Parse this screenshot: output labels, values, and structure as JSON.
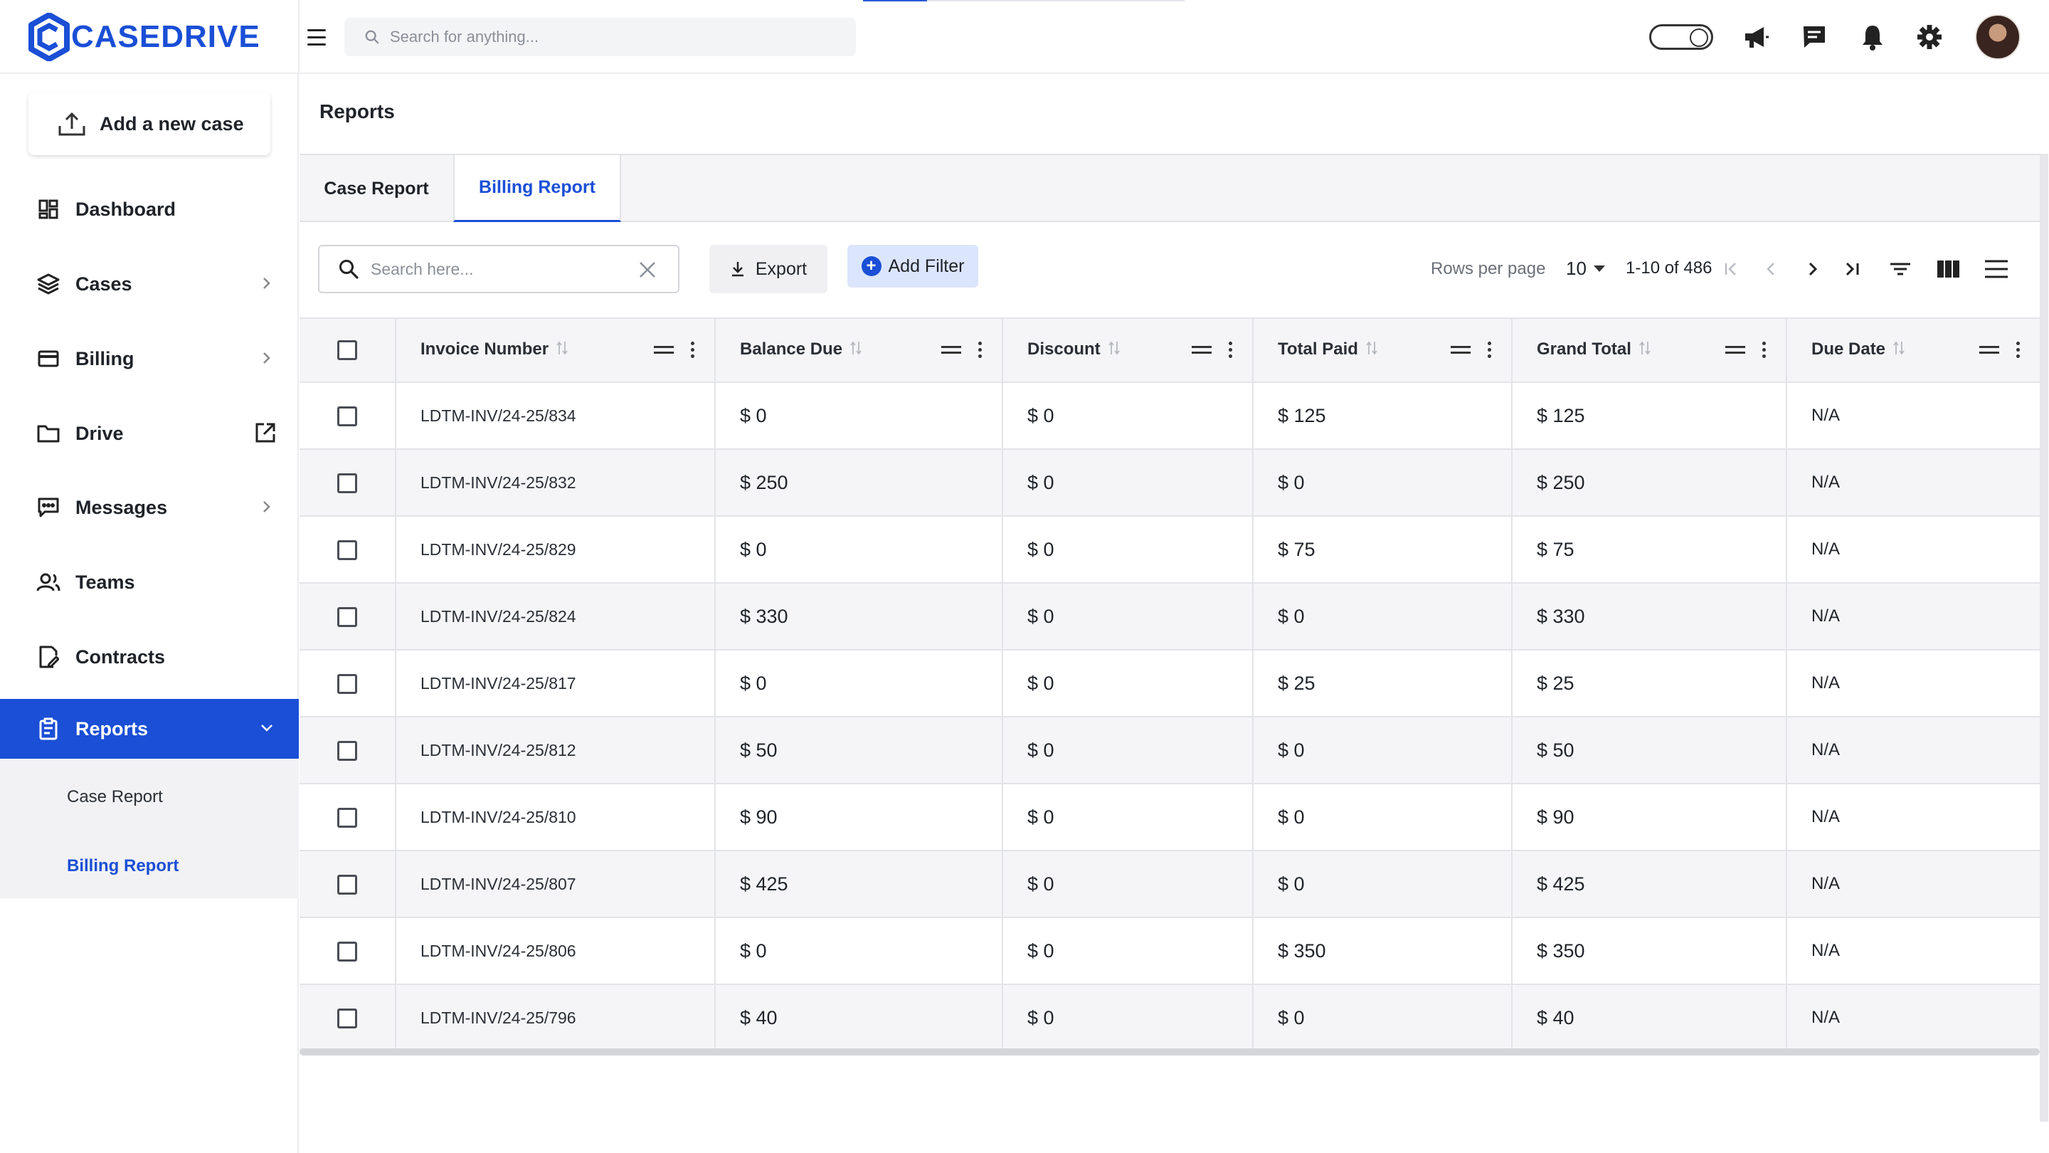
{
  "app": {
    "brand": "CASEDRIVE",
    "brand_color": "#1a4fd6",
    "loading_progress": 0.2
  },
  "topbar": {
    "search_placeholder": "Search for anything...",
    "icons": [
      "menu-icon",
      "search-icon",
      "theme-toggle",
      "megaphone-icon",
      "chat-icon",
      "bell-icon",
      "gear-icon",
      "avatar"
    ]
  },
  "sidebar": {
    "add_case_label": "Add a new case",
    "items": [
      {
        "label": "Dashboard",
        "icon": "dashboard-icon"
      },
      {
        "label": "Cases",
        "icon": "layers-icon"
      },
      {
        "label": "Billing",
        "icon": "card-icon"
      },
      {
        "label": "Drive",
        "icon": "folder-icon"
      },
      {
        "label": "Messages",
        "icon": "message-icon"
      },
      {
        "label": "Teams",
        "icon": "team-icon"
      },
      {
        "label": "Contracts",
        "icon": "contract-icon"
      },
      {
        "label": "Reports",
        "icon": "clipboard-icon"
      }
    ],
    "submenu": [
      {
        "label": "Case Report"
      },
      {
        "label": "Billing Report"
      }
    ]
  },
  "main": {
    "title": "Reports",
    "tabs": [
      {
        "label": "Case Report"
      },
      {
        "label": "Billing Report"
      }
    ],
    "toolbar": {
      "search_placeholder": "Search here...",
      "export_label": "Export",
      "add_filter_label": "Add Filter",
      "rows_per_page_label": "Rows per page",
      "rows_per_page_value": "10",
      "range_text": "1-10 of 486"
    },
    "table": {
      "columns": [
        "Invoice Number",
        "Balance Due",
        "Discount",
        "Total Paid",
        "Grand Total",
        "Due Date"
      ],
      "rows": [
        [
          "LDTM-INV/24-25/834",
          "$ 0",
          "$ 0",
          "$ 125",
          "$ 125",
          "N/A"
        ],
        [
          "LDTM-INV/24-25/832",
          "$ 250",
          "$ 0",
          "$ 0",
          "$ 250",
          "N/A"
        ],
        [
          "LDTM-INV/24-25/829",
          "$ 0",
          "$ 0",
          "$ 75",
          "$ 75",
          "N/A"
        ],
        [
          "LDTM-INV/24-25/824",
          "$ 330",
          "$ 0",
          "$ 0",
          "$ 330",
          "N/A"
        ],
        [
          "LDTM-INV/24-25/817",
          "$ 0",
          "$ 0",
          "$ 25",
          "$ 25",
          "N/A"
        ],
        [
          "LDTM-INV/24-25/812",
          "$ 50",
          "$ 0",
          "$ 0",
          "$ 50",
          "N/A"
        ],
        [
          "LDTM-INV/24-25/810",
          "$ 90",
          "$ 0",
          "$ 0",
          "$ 90",
          "N/A"
        ],
        [
          "LDTM-INV/24-25/807",
          "$ 425",
          "$ 0",
          "$ 0",
          "$ 425",
          "N/A"
        ],
        [
          "LDTM-INV/24-25/806",
          "$ 0",
          "$ 0",
          "$ 350",
          "$ 350",
          "N/A"
        ],
        [
          "LDTM-INV/24-25/796",
          "$ 40",
          "$ 0",
          "$ 0",
          "$ 40",
          "N/A"
        ]
      ]
    }
  }
}
